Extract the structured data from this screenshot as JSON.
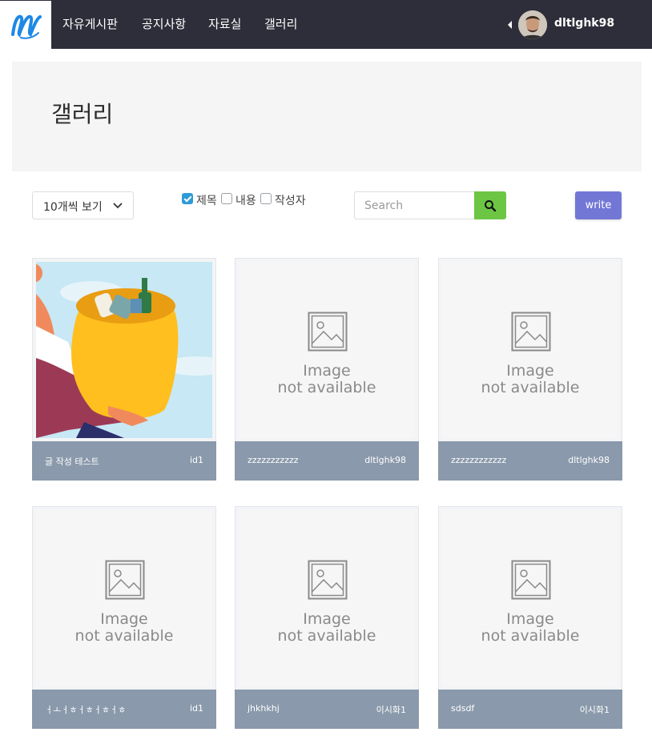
{
  "nav": {
    "items": [
      "자유게시판",
      "공지사항",
      "자료실",
      "갤러리"
    ],
    "username": "dltlghk98"
  },
  "page": {
    "title": "갤러리"
  },
  "controls": {
    "per_page": "10개씩 보기",
    "filters": [
      {
        "label": "제목",
        "checked": true
      },
      {
        "label": "내용",
        "checked": false
      },
      {
        "label": "작성자",
        "checked": false
      }
    ],
    "search_placeholder": "Search",
    "write_label": "write"
  },
  "placeholder_image": {
    "line1": "Image",
    "line2": "not available"
  },
  "cards": [
    {
      "title": "글 작성 테스트",
      "author": "id1",
      "image": "illustration"
    },
    {
      "title": "zzzzzzzzzzz",
      "author": "dltlghk98",
      "image": "not-available"
    },
    {
      "title": "zzzzzzzzzzzz",
      "author": "dltlghk98",
      "image": "not-available"
    },
    {
      "title": "ㅓㅗㅓㅎㅓㅎㅓㅎㅓㅎ",
      "author": "id1",
      "image": "not-available"
    },
    {
      "title": "jhkhkhj",
      "author": "이시화1",
      "image": "not-available"
    },
    {
      "title": "sdsdf",
      "author": "이시화1",
      "image": "not-available"
    }
  ],
  "colors": {
    "topbar": "#2e2e3a",
    "search_button": "#6cc644",
    "write_button": "#7277d6",
    "card_bar": "#8a99ab",
    "checkbox_checked": "#2e9bd6"
  }
}
